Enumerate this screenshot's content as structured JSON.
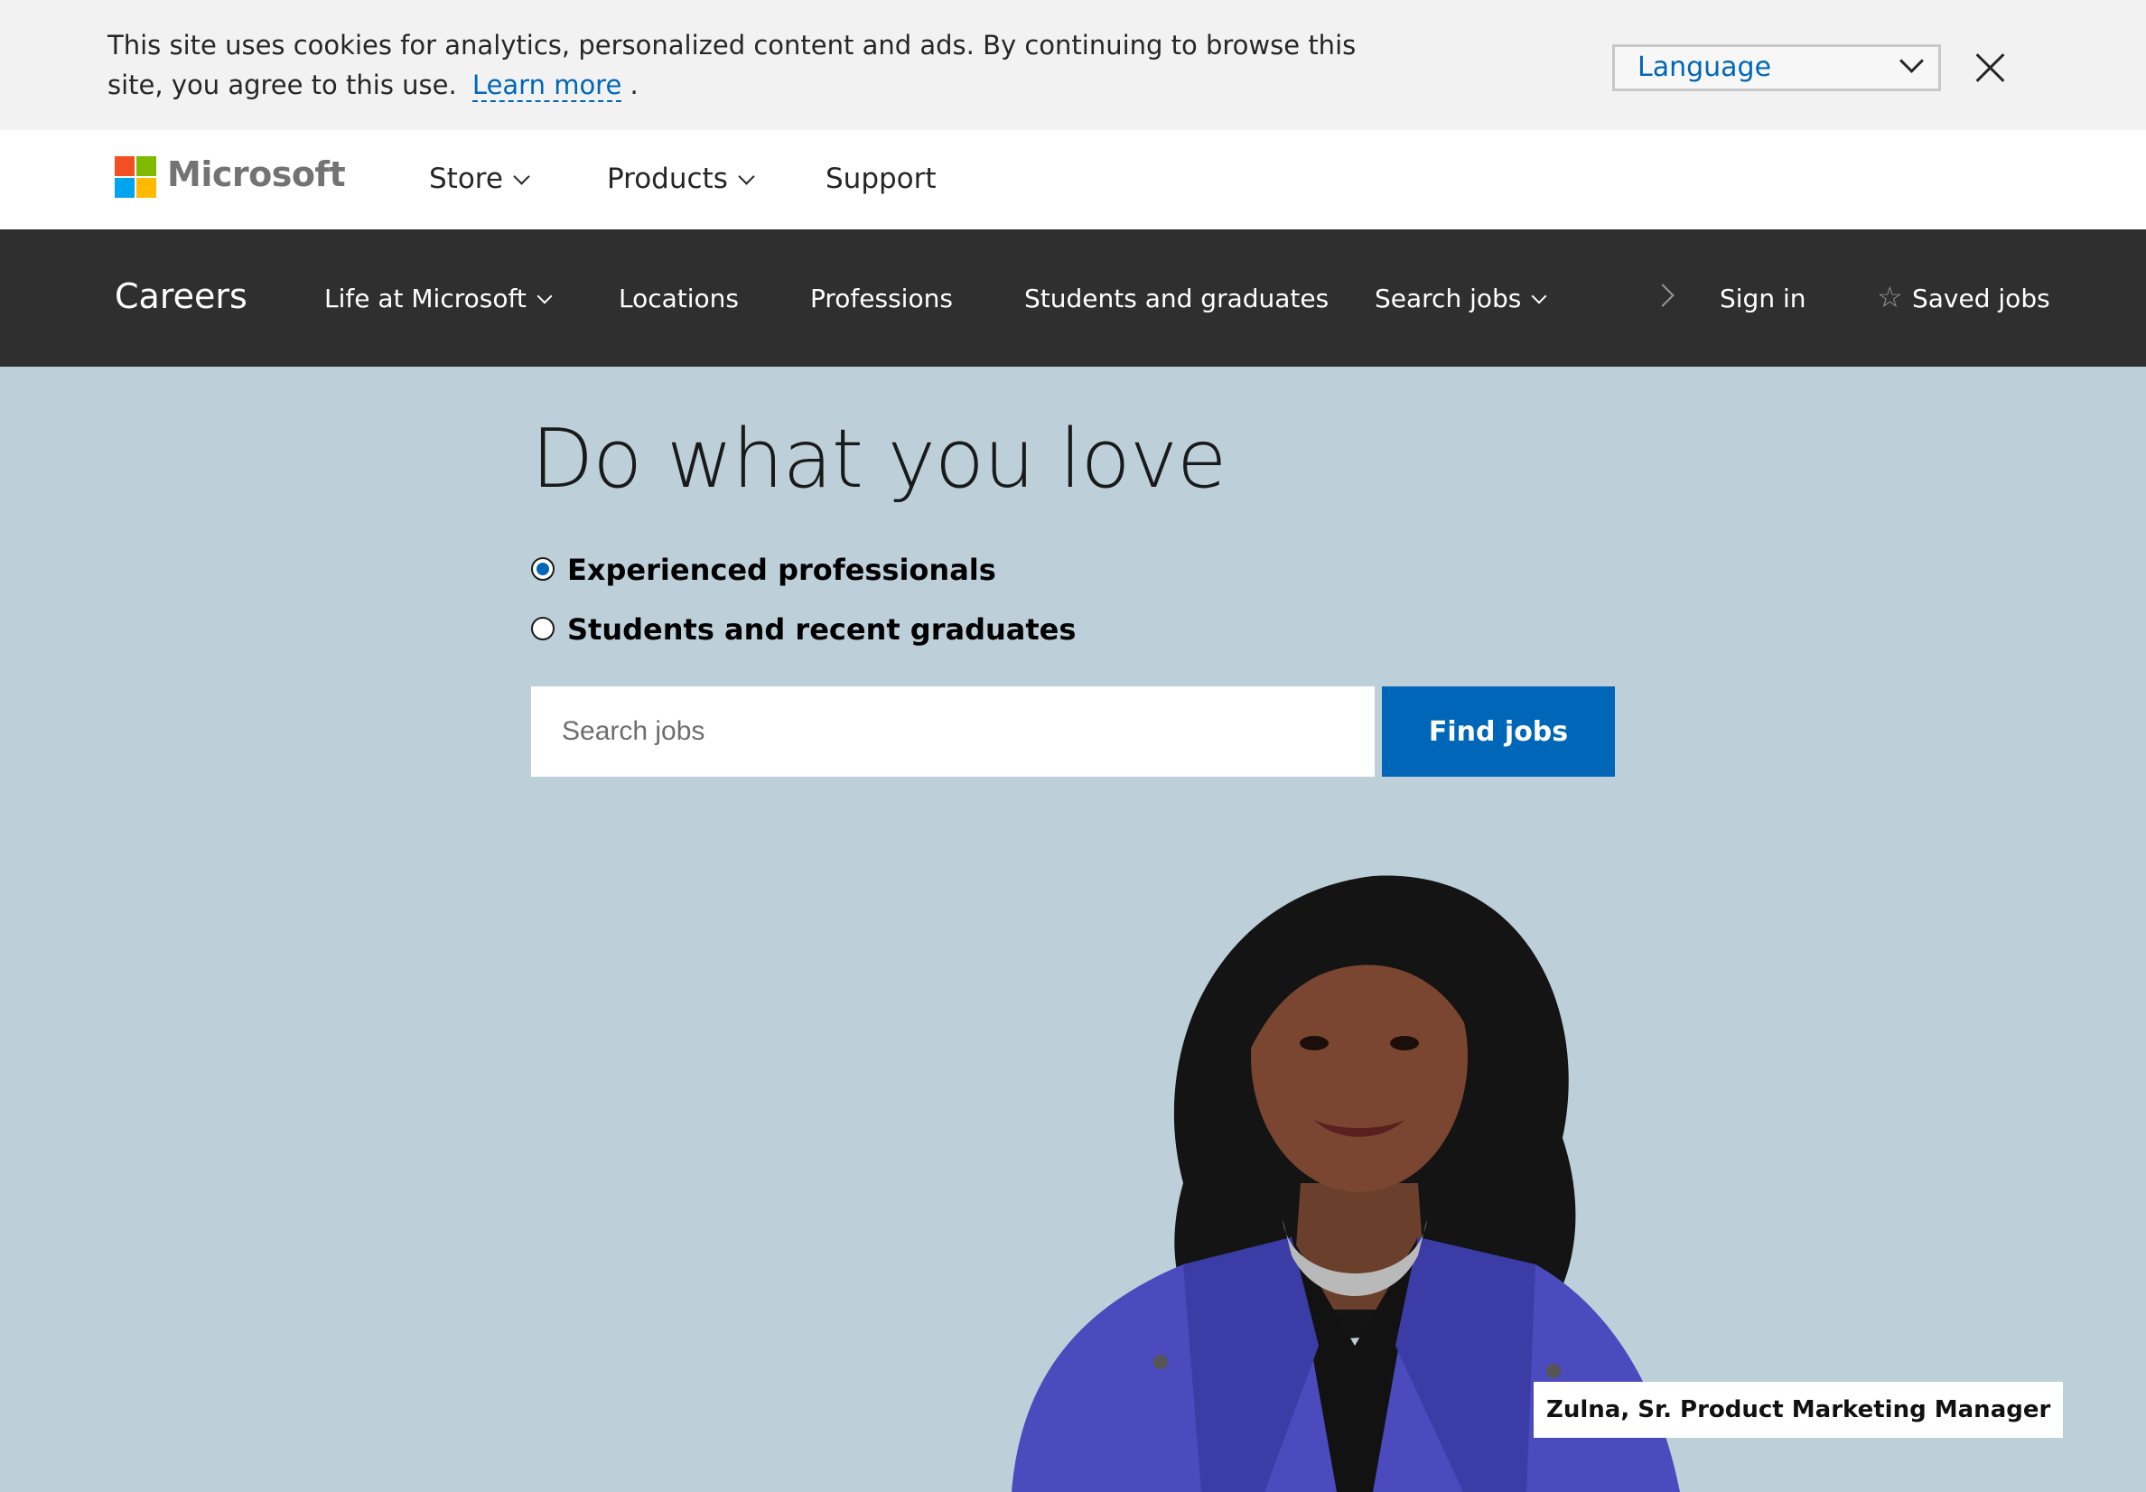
{
  "cookie_banner": {
    "text": "This site uses cookies for analytics, personalized content and ads. By continuing to browse this site, you agree to this use.",
    "learn_more": "Learn more",
    "period": ".",
    "language_label": "Language"
  },
  "header": {
    "brand": "Microsoft",
    "nav": [
      {
        "label": "Store"
      },
      {
        "label": "Products"
      },
      {
        "label": "Support"
      }
    ]
  },
  "careers_nav": {
    "title": "Careers",
    "items": [
      {
        "label": "Life at Microsoft"
      },
      {
        "label": "Locations"
      },
      {
        "label": "Professions"
      },
      {
        "label": "Students and graduates"
      },
      {
        "label": "Search jobs"
      }
    ],
    "sign_in": "Sign in",
    "saved_jobs": "Saved jobs"
  },
  "hero": {
    "title": "Do what you love",
    "options": [
      {
        "label": "Experienced professionals",
        "selected": true
      },
      {
        "label": "Students and recent graduates",
        "selected": false
      }
    ],
    "search_placeholder": "Search jobs",
    "find_button": "Find jobs",
    "caption": "Zulna, Sr. Product Marketing Manager"
  },
  "colors": {
    "accent": "#0067b8",
    "hero_bg": "#bdd0da",
    "nav_bg": "#2f2f2f"
  }
}
